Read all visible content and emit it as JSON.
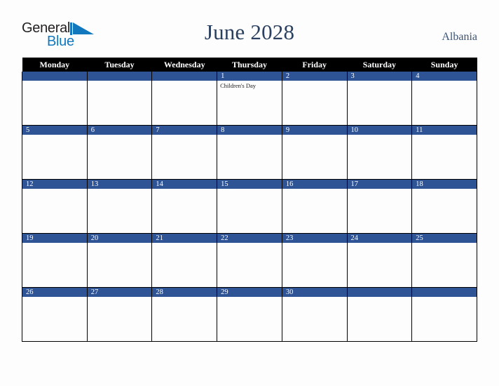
{
  "brand": {
    "name_part1": "General",
    "name_part2": "Blue",
    "triangle_icon": "blue-triangle-icon",
    "colors": {
      "text_dark": "#231f20",
      "text_blue": "#1278be"
    }
  },
  "header": {
    "title": "June 2028",
    "country": "Albania"
  },
  "theme": {
    "header_bg": "#000000",
    "day_bar_blue": "#2f5496",
    "title_navy": "#2b4061",
    "page_bg": "#fdfdfd",
    "grid_line": "#000000"
  },
  "calendar": {
    "month": "June",
    "year": "2028",
    "weekday_headers": [
      "Monday",
      "Tuesday",
      "Wednesday",
      "Thursday",
      "Friday",
      "Saturday",
      "Sunday"
    ],
    "weeks": [
      [
        {
          "day": "",
          "events": []
        },
        {
          "day": "",
          "events": []
        },
        {
          "day": "",
          "events": []
        },
        {
          "day": "1",
          "events": [
            "Children's Day"
          ]
        },
        {
          "day": "2",
          "events": []
        },
        {
          "day": "3",
          "events": []
        },
        {
          "day": "4",
          "events": []
        }
      ],
      [
        {
          "day": "5",
          "events": []
        },
        {
          "day": "6",
          "events": []
        },
        {
          "day": "7",
          "events": []
        },
        {
          "day": "8",
          "events": []
        },
        {
          "day": "9",
          "events": []
        },
        {
          "day": "10",
          "events": []
        },
        {
          "day": "11",
          "events": []
        }
      ],
      [
        {
          "day": "12",
          "events": []
        },
        {
          "day": "13",
          "events": []
        },
        {
          "day": "14",
          "events": []
        },
        {
          "day": "15",
          "events": []
        },
        {
          "day": "16",
          "events": []
        },
        {
          "day": "17",
          "events": []
        },
        {
          "day": "18",
          "events": []
        }
      ],
      [
        {
          "day": "19",
          "events": []
        },
        {
          "day": "20",
          "events": []
        },
        {
          "day": "21",
          "events": []
        },
        {
          "day": "22",
          "events": []
        },
        {
          "day": "23",
          "events": []
        },
        {
          "day": "24",
          "events": []
        },
        {
          "day": "25",
          "events": []
        }
      ],
      [
        {
          "day": "26",
          "events": []
        },
        {
          "day": "27",
          "events": []
        },
        {
          "day": "28",
          "events": []
        },
        {
          "day": "29",
          "events": []
        },
        {
          "day": "30",
          "events": []
        },
        {
          "day": "",
          "events": []
        },
        {
          "day": "",
          "events": []
        }
      ]
    ]
  }
}
